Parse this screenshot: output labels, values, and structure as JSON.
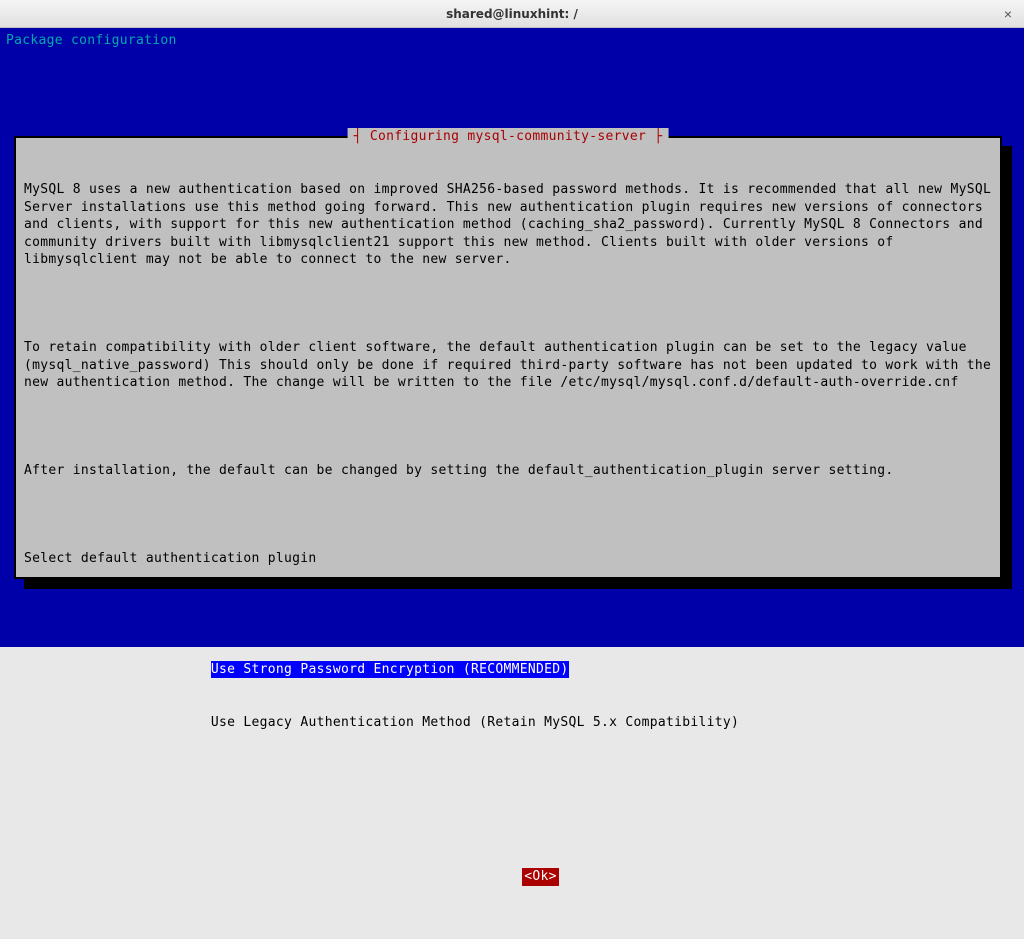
{
  "window": {
    "title": "shared@linuxhint: /",
    "close_glyph": "×"
  },
  "terminal": {
    "header": "Package configuration"
  },
  "dialog": {
    "title_decorated": "┤ Configuring mysql-community-server ├",
    "paragraph1": "MySQL 8 uses a new authentication based on improved SHA256-based password methods. It is recommended that all new MySQL Server installations use this method going forward. This new authentication plugin requires new versions of connectors and clients, with support for this new authentication method (caching_sha2_password). Currently MySQL 8 Connectors and community drivers built with libmysqlclient21 support this new method. Clients built with older versions of libmysqlclient may not be able to connect to the new server.",
    "paragraph2": "To retain compatibility with older client software, the default authentication plugin can be set to the legacy value (mysql_native_password) This should only be done if required third-party software has not been updated to work with the new authentication method. The change will be written to the file /etc/mysql/mysql.conf.d/default-auth-override.cnf",
    "paragraph3": "After installation, the default can be changed by setting the default_authentication_plugin server setting.",
    "prompt": "Select default authentication plugin",
    "options": [
      "Use Strong Password Encryption (RECOMMENDED)",
      "Use Legacy Authentication Method (Retain MySQL 5.x Compatibility)"
    ],
    "option_indent": "                       ",
    "ok_label": "<Ok>"
  }
}
